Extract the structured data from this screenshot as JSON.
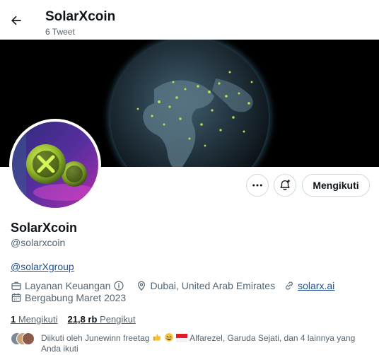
{
  "header": {
    "title": "SolarXcoin",
    "tweet_count": "6 Tweet"
  },
  "profile": {
    "display_name": "SolarXcoin",
    "handle": "@solarxcoin",
    "bio_link": "@solarXgroup",
    "category": "Layanan Keuangan",
    "location": "Dubai, United Arab Emirates",
    "website": "solarx.ai",
    "joined": "Bergabung Maret 2023"
  },
  "actions": {
    "follow_label": "Mengikuti"
  },
  "stats": {
    "following_count": "1",
    "following_label": "Mengikuti",
    "followers_count": "21,8 rb",
    "followers_label": "Pengikut"
  },
  "known_followers": {
    "prefix": "Diikuti oleh Junewinn freetag",
    "suffix": "Alfarezel, Garuda Sejati, dan 4 lainnya yang Anda ikuti"
  },
  "icons": {
    "back": "arrow-left-icon",
    "more": "more-horizontal-icon",
    "notify": "bell-plus-icon",
    "category": "briefcase-icon",
    "info": "info-icon",
    "location": "location-pin-icon",
    "website": "link-icon",
    "joined": "calendar-icon"
  },
  "colors": {
    "text_primary": "#0f1419",
    "text_secondary": "#536471",
    "link": "#1d4f91",
    "border": "#cfd9de",
    "banner_bg": "#000000"
  }
}
